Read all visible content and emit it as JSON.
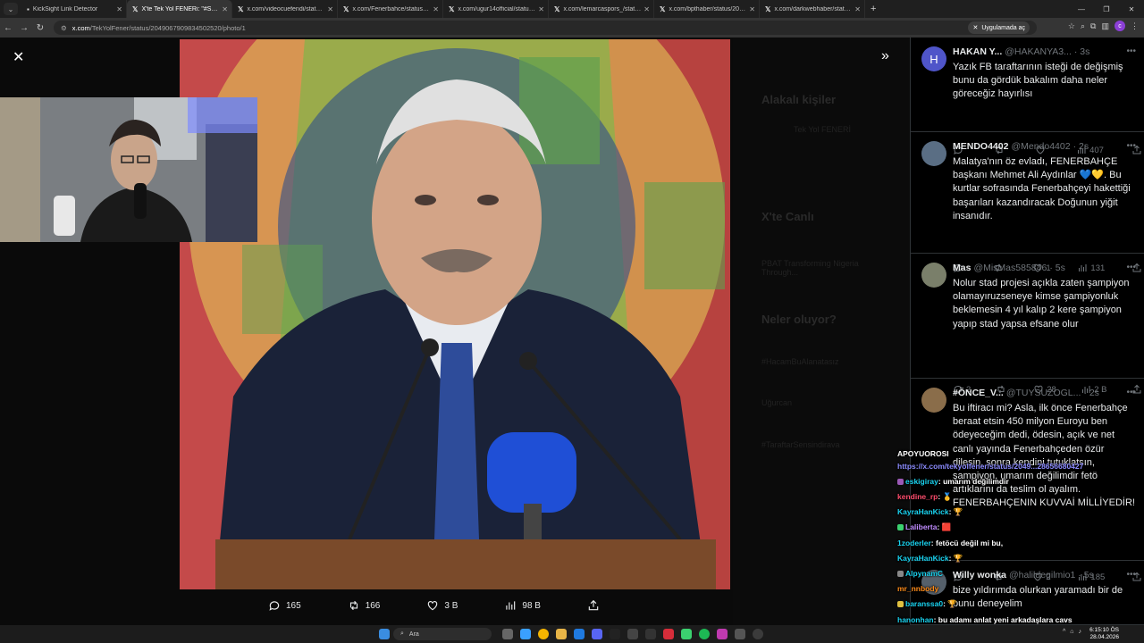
{
  "browser": {
    "tabs": [
      {
        "title": "KickSight Link Detector",
        "active": false
      },
      {
        "title": "X'te Tek Yol FENERi: \"#SONDAKİKA\"",
        "active": true
      },
      {
        "title": "x.com/videocuefendi/status/2049",
        "active": false
      },
      {
        "title": "x.com/Fenerbahce/status/2049",
        "active": false
      },
      {
        "title": "x.com/ugur14official/status/2049",
        "active": false
      },
      {
        "title": "x.com/lemarcaspors_/status/2049",
        "active": false
      },
      {
        "title": "x.com/bpthaber/status/20490",
        "active": false
      },
      {
        "title": "x.com/darkwebhaber/status/20490",
        "active": false
      }
    ],
    "url_host": "x.com",
    "url_path": "/TekYolFener/status/2049067909834502520/photo/1",
    "open_in_app_label": "Uygulamada aç",
    "profile_initial": "c"
  },
  "ghost_sidebar": {
    "related_people": "Alakalı kişiler",
    "related_name": "Tek Yol FENERİ",
    "live_on_x": "X'te Canlı",
    "live_title": "PBAT Transforming Nigeria Through...",
    "whats_happening": "Neler oluyor?",
    "trend1": "#HacamBuAlanatasız",
    "trend2": "Uğurcan",
    "trend3": "#TaraftarSensindirava"
  },
  "photo_actions": {
    "replies": "165",
    "reposts": "166",
    "likes": "3 B",
    "views": "98 B"
  },
  "replies": [
    {
      "avatar_letter": "H",
      "avatar_color": "#4f55c9",
      "name": "HAKAN Y...",
      "handle": "@HAKANYA3...",
      "time": "· 3s",
      "text": "Yazık FB taraftarının isteği de değişmiş bunu da gördük bakalım daha neler göreceğiz hayırlısı",
      "reply_count": "",
      "repost_count": "",
      "like_count": "",
      "views": "407"
    },
    {
      "avatar_letter": "",
      "avatar_color": "#5a6e84",
      "name": "MENDO4402",
      "handle": "@Mendo4402",
      "time": "· 2s",
      "text": "Malatya'nın öz evladı, FENERBAHÇE başkanı Mehmet Ali Aydınlar 💙💛. Bu kurtlar sofrasında Fenerbahçeyi hakettiği başarıları kazandıracak Doğunun yiğit insanıdır.",
      "reply_count": "",
      "repost_count": "",
      "like_count": "1",
      "views": "131"
    },
    {
      "avatar_letter": "",
      "avatar_color": "#7a7f6a",
      "name": "Mas",
      "handle": "@MisMas585846",
      "time": "· 5s",
      "text": "Nolur stad projesi açıkla zaten şampiyon olamayıruzseneye kimse şampiyonluk beklemesin 4 yıl kalıp 2 kere şampiyon yapıp stad yapsa efsane olur",
      "reply_count": "2",
      "repost_count": "",
      "like_count": "28",
      "views": "2 B"
    },
    {
      "avatar_letter": "",
      "avatar_color": "#8a6d4a",
      "name": "#ÖNCE_V...",
      "handle": "@TUYSUZOGL...",
      "time": "· 2s",
      "text": "Bu iftiracı mi? Asla, ilk önce Fenerbahçe beraat etsin 450 milyon Euroyu ben ödeyeceğim dedi, ödesin, açık ve net canlı yayında Fenerbahçeden özür dilesin, sonra kendini tutuklatsın, şampiyon, umarım değilimdir fetö artıklarını da teslim ol ayalım. FENERBAHÇENIN KUVVAİ MİLLİYEDİR!",
      "reply_count": "",
      "repost_count": "",
      "like_count": "2",
      "views": "185"
    },
    {
      "avatar_letter": "",
      "avatar_color": "#55606b",
      "name": "Willy wonka",
      "handle": "@halildegilmio1",
      "time": "· 5s",
      "text": "bize yıldırımda olurkan yaramadı bir de bunu deneyelim",
      "reply_count": "",
      "repost_count": "",
      "like_count": "",
      "views": ""
    }
  ],
  "chat": [
    {
      "user": "APOYUOROSI",
      "msg": "",
      "user_color": "#ffffff",
      "badge": ""
    },
    {
      "user": "",
      "msg": "https://x.com/tekyolfener/status/2049...28656680427",
      "user_color": "#8b8bff",
      "badge": ""
    },
    {
      "user": "eskigiray",
      "msg": ": umarım değilimdir",
      "user_color": "#19d3f0",
      "badge": "#9b59b6"
    },
    {
      "user": "kendine_rp",
      "msg": ": 🥇",
      "user_color": "#ff4d6d",
      "badge": ""
    },
    {
      "user": "KayraHanKick",
      "msg": ": 🏆",
      "user_color": "#19d3f0",
      "badge": ""
    },
    {
      "user": "Laliberta",
      "msg": ": 🟥",
      "user_color": "#c08cff",
      "badge": "#3bd16f"
    },
    {
      "user": "1zoderler",
      "msg": ": fetöcü değil mi bu,",
      "user_color": "#19d3f0",
      "badge": ""
    },
    {
      "user": "KayraHanKick",
      "msg": ": 🏆",
      "user_color": "#19d3f0",
      "badge": ""
    },
    {
      "user": "AlpynamC",
      "msg": "",
      "user_color": "#19d3f0",
      "badge": "#888888"
    },
    {
      "user": "mr_nnbody",
      "msg": "",
      "user_color": "#ff8c1a",
      "badge": ""
    },
    {
      "user": "baranssa0",
      "msg": ": 🏆",
      "user_color": "#19d3f0",
      "badge": "#e0c040"
    },
    {
      "user": "hanonhan",
      "msg": ": bu adamı anlat yeni arkadaşlara cavs",
      "user_color": "#19d3f0",
      "badge": ""
    },
    {
      "user": "Laliberta",
      "msg": ": 🟥",
      "user_color": "#c08cff",
      "badge": "#3bd16f"
    }
  ],
  "taskbar": {
    "search_label": "Ara",
    "time": "6:15:10 ÖS",
    "date": "28.04.2026"
  },
  "colors": {
    "x_blue": "#1d9bf0",
    "muted": "#71767b",
    "border": "#2f3336"
  }
}
